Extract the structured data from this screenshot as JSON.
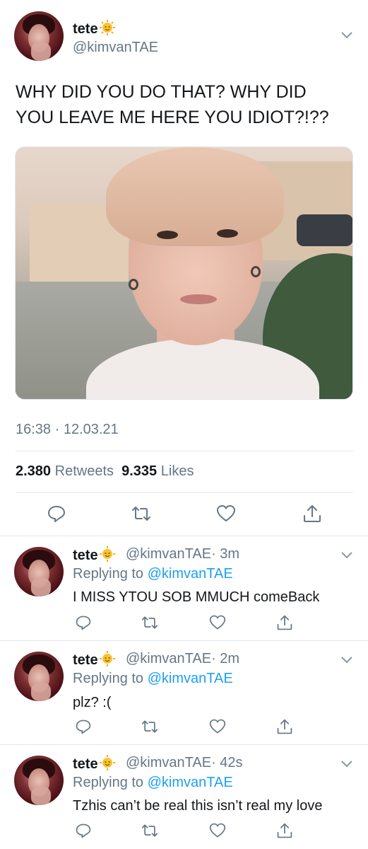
{
  "main_tweet": {
    "name": "tete",
    "handle": "@kimvanTAE",
    "text_line1": "WHY DID YOU DO THAT? WHY DID",
    "text_line2": "YOU LEAVE ME HERE YOU IDIOT?!??",
    "timestamp": "16:38 · 12.03.21",
    "retweets_count": "2.380",
    "retweets_label": "Retweets",
    "likes_count": "9.335",
    "likes_label": "Likes"
  },
  "replies": [
    {
      "name": "tete",
      "handle": "@kimvanTAE",
      "time": "· 3m",
      "replying_prefix": "Replying to",
      "replying_to": "@kimvanTAE",
      "text": "I MISS YTOU SOB MMUCH comeBack"
    },
    {
      "name": "tete",
      "handle": "@kimvanTAE",
      "time": "· 2m",
      "replying_prefix": "Replying to",
      "replying_to": "@kimvanTAE",
      "text": "plz? :("
    },
    {
      "name": "tete",
      "handle": "@kimvanTAE",
      "time": "· 42s",
      "replying_prefix": "Replying to",
      "replying_to": "@kimvanTAE",
      "text": "Tzhis can’t be real this isn’t real my love"
    }
  ],
  "icons": {
    "reply": "reply-bubble-icon",
    "retweet": "retweet-icon",
    "like": "heart-icon",
    "share": "share-icon",
    "more": "chevron-down-icon",
    "emoji": "sun-emoji-icon"
  },
  "colors": {
    "text": "#14171a",
    "secondary": "#657786",
    "link": "#1da1f2",
    "divider": "#e1e8ed"
  }
}
